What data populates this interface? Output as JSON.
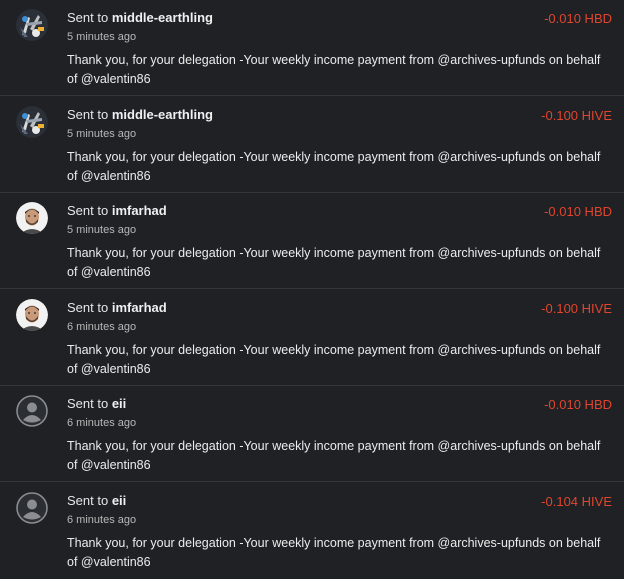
{
  "colors": {
    "background": "#1f2125",
    "divider": "#33363b",
    "amount_negative": "#e0462d",
    "text_primary": "#ececec",
    "text_secondary": "#b8b8b8"
  },
  "transactions": [
    {
      "avatar_icon": "middle-earthling-avatar-icon",
      "prefix": "Sent to",
      "recipient": "middle-earthling",
      "time": "5 minutes ago",
      "amount": "-0.010 HBD",
      "memo": "Thank you, for your delegation -Your weekly income payment from @archives-upfunds on behalf of @valentin86"
    },
    {
      "avatar_icon": "middle-earthling-avatar-icon",
      "prefix": "Sent to",
      "recipient": "middle-earthling",
      "time": "5 minutes ago",
      "amount": "-0.100 HIVE",
      "memo": "Thank you, for your delegation -Your weekly income payment from @archives-upfunds on behalf of @valentin86"
    },
    {
      "avatar_icon": "imfarhad-avatar-icon",
      "prefix": "Sent to",
      "recipient": "imfarhad",
      "time": "5 minutes ago",
      "amount": "-0.010 HBD",
      "memo": "Thank you, for your delegation -Your weekly income payment from @archives-upfunds on behalf of @valentin86"
    },
    {
      "avatar_icon": "imfarhad-avatar-icon",
      "prefix": "Sent to",
      "recipient": "imfarhad",
      "time": "6 minutes ago",
      "amount": "-0.100 HIVE",
      "memo": "Thank you, for your delegation -Your weekly income payment from @archives-upfunds on behalf of @valentin86"
    },
    {
      "avatar_icon": "default-user-avatar-icon",
      "prefix": "Sent to",
      "recipient": "eii",
      "time": "6 minutes ago",
      "amount": "-0.010 HBD",
      "memo": "Thank you, for your delegation -Your weekly income payment from @archives-upfunds on behalf of @valentin86"
    },
    {
      "avatar_icon": "default-user-avatar-icon",
      "prefix": "Sent to",
      "recipient": "eii",
      "time": "6 minutes ago",
      "amount": "-0.104 HIVE",
      "memo": "Thank you, for your delegation -Your weekly income payment from @archives-upfunds on behalf of @valentin86"
    }
  ]
}
